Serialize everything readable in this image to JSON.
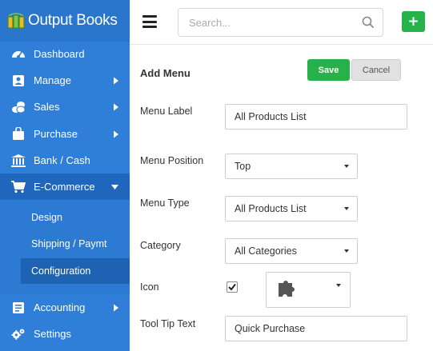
{
  "app": {
    "brand": "Output Books"
  },
  "sidebar": {
    "items": [
      {
        "label": "Dashboard",
        "icon": "dashboard-icon",
        "has_caret": false
      },
      {
        "label": "Manage",
        "icon": "contacts-icon",
        "has_caret": true
      },
      {
        "label": "Sales",
        "icon": "coins-icon",
        "has_caret": true
      },
      {
        "label": "Purchase",
        "icon": "shopping-bag-icon",
        "has_caret": true
      },
      {
        "label": "Bank / Cash",
        "icon": "bank-icon",
        "has_caret": false
      },
      {
        "label": "E-Commerce",
        "icon": "cart-icon",
        "has_caret": true,
        "expanded": true
      },
      {
        "label": "Accounting",
        "icon": "ledger-icon",
        "has_caret": true
      },
      {
        "label": "Settings",
        "icon": "gears-icon",
        "has_caret": false
      }
    ],
    "sub_items": [
      "Design",
      "Shipping / Paymt",
      "Configuration"
    ],
    "active_sub_item": "Configuration"
  },
  "topbar": {
    "search_placeholder": "Search..."
  },
  "form": {
    "title": "Add Menu",
    "save_label": "Save",
    "cancel_label": "Cancel",
    "menu_label": {
      "label": "Menu Label",
      "value": "All Products List"
    },
    "menu_position": {
      "label": "Menu Position",
      "value": "Top"
    },
    "menu_type": {
      "label": "Menu Type",
      "value": "All Products List"
    },
    "category": {
      "label": "Category",
      "value": "All Categories"
    },
    "icon": {
      "label": "Icon",
      "checked": true,
      "selected_icon": "puzzle-piece-icon"
    },
    "tooltip": {
      "label": "Tool Tip Text",
      "value": "Quick Purchase"
    }
  },
  "colors": {
    "sidebar_bg": "#2f7fd8",
    "sidebar_active": "#1e67bd",
    "accent_green": "#27b14a"
  }
}
